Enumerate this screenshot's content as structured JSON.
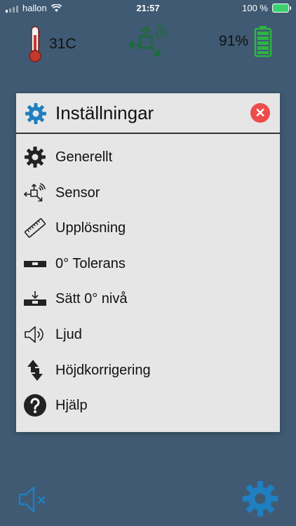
{
  "status_bar": {
    "carrier": "hallon",
    "time": "21:57",
    "battery_percent": "100 %"
  },
  "indicators": {
    "temperature": "31C",
    "battery": "91%"
  },
  "settings_dialog": {
    "title": "Inställningar",
    "items": [
      {
        "label": "Generellt",
        "icon": "gear-icon"
      },
      {
        "label": "Sensor",
        "icon": "sensor-icon"
      },
      {
        "label": "Upplösning",
        "icon": "ruler-icon"
      },
      {
        "label": "0° Tolerans",
        "icon": "level-icon"
      },
      {
        "label": "Sätt 0° nivå",
        "icon": "set-zero-level-icon"
      },
      {
        "label": "Ljud",
        "icon": "speaker-icon"
      },
      {
        "label": "Höjdkorrigering",
        "icon": "height-correction-icon"
      },
      {
        "label": "Hjälp",
        "icon": "help-icon"
      }
    ]
  },
  "colors": {
    "background": "#3f5a72",
    "dialog": "#e6e6e6",
    "accent_blue": "#1f7fc0",
    "close_red": "#ee4b4b",
    "sensor_green": "#1e6b3c",
    "battery_green": "#2fb344",
    "thermometer_red": "#c0392b"
  }
}
